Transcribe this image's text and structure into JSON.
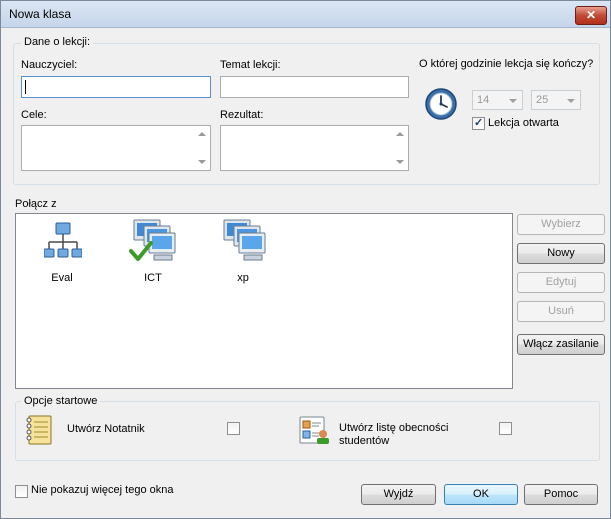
{
  "window": {
    "title": "Nowa klasa"
  },
  "lesson_group": {
    "legend": "Dane o lekcji:",
    "teacher_label": "Nauczyciel:",
    "teacher_value": "",
    "topic_label": "Temat lekcji:",
    "topic_value": "",
    "goals_label": "Cele:",
    "goals_value": "",
    "result_label": "Rezultat:",
    "result_value": "",
    "end_time_label": "O której godzinie lekcja się kończy?",
    "hour": "14",
    "minute": "25",
    "open_lesson_label": "Lekcja otwarta",
    "open_lesson_checked": true
  },
  "connect": {
    "label": "Połącz z",
    "items": [
      {
        "label": "Eval",
        "icon": "network-icon"
      },
      {
        "label": "ICT",
        "icon": "computer-group-checked-icon"
      },
      {
        "label": "xp",
        "icon": "computer-group-icon"
      }
    ]
  },
  "side_buttons": {
    "select": "Wybierz",
    "new": "Nowy",
    "edit": "Edytuj",
    "delete": "Usuń",
    "power_on": "Włącz zasilanie"
  },
  "startup": {
    "legend": "Opcje startowe",
    "notebook_label": "Utwórz Notatnik",
    "notebook_checked": false,
    "attendance_label_line1": "Utwórz listę obecności",
    "attendance_label_line2": "studentów",
    "attendance_checked": false
  },
  "footer": {
    "dont_show_label": "Nie pokazuj więcej tego okna",
    "dont_show_checked": false,
    "exit": "Wyjdź",
    "ok": "OK",
    "help": "Pomoc"
  }
}
